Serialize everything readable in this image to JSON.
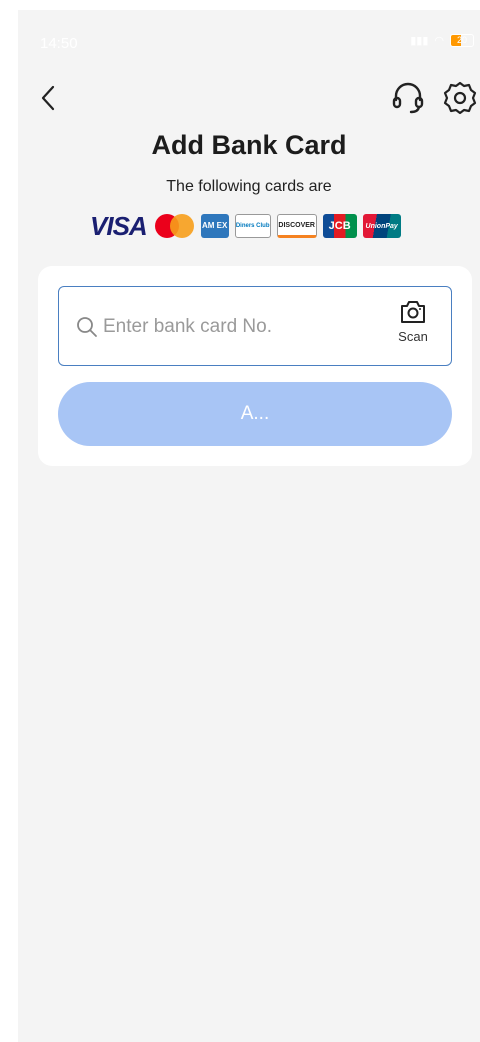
{
  "status_bar": {
    "time": "14:50",
    "battery": "20"
  },
  "header": {
    "title": "Add Bank Card",
    "subtitle": "The following cards are"
  },
  "brands": {
    "visa": "VISA",
    "amex": "AM EX",
    "diners": "Diners Club",
    "discover": "DISCOVER",
    "jcb": "JCB",
    "unionpay": "UnionPay"
  },
  "form": {
    "card_input_placeholder": "Enter bank card No.",
    "card_input_value": "",
    "scan_label": "Scan",
    "add_button_label": "A..."
  },
  "colors": {
    "accent": "#4a7fc1",
    "button_disabled": "#a8c5f5",
    "background": "#f4f4f4"
  },
  "icons": {
    "back": "chevron-left-icon",
    "support": "headset-icon",
    "settings": "gear-icon",
    "search": "search-icon",
    "scan": "camera-icon"
  }
}
